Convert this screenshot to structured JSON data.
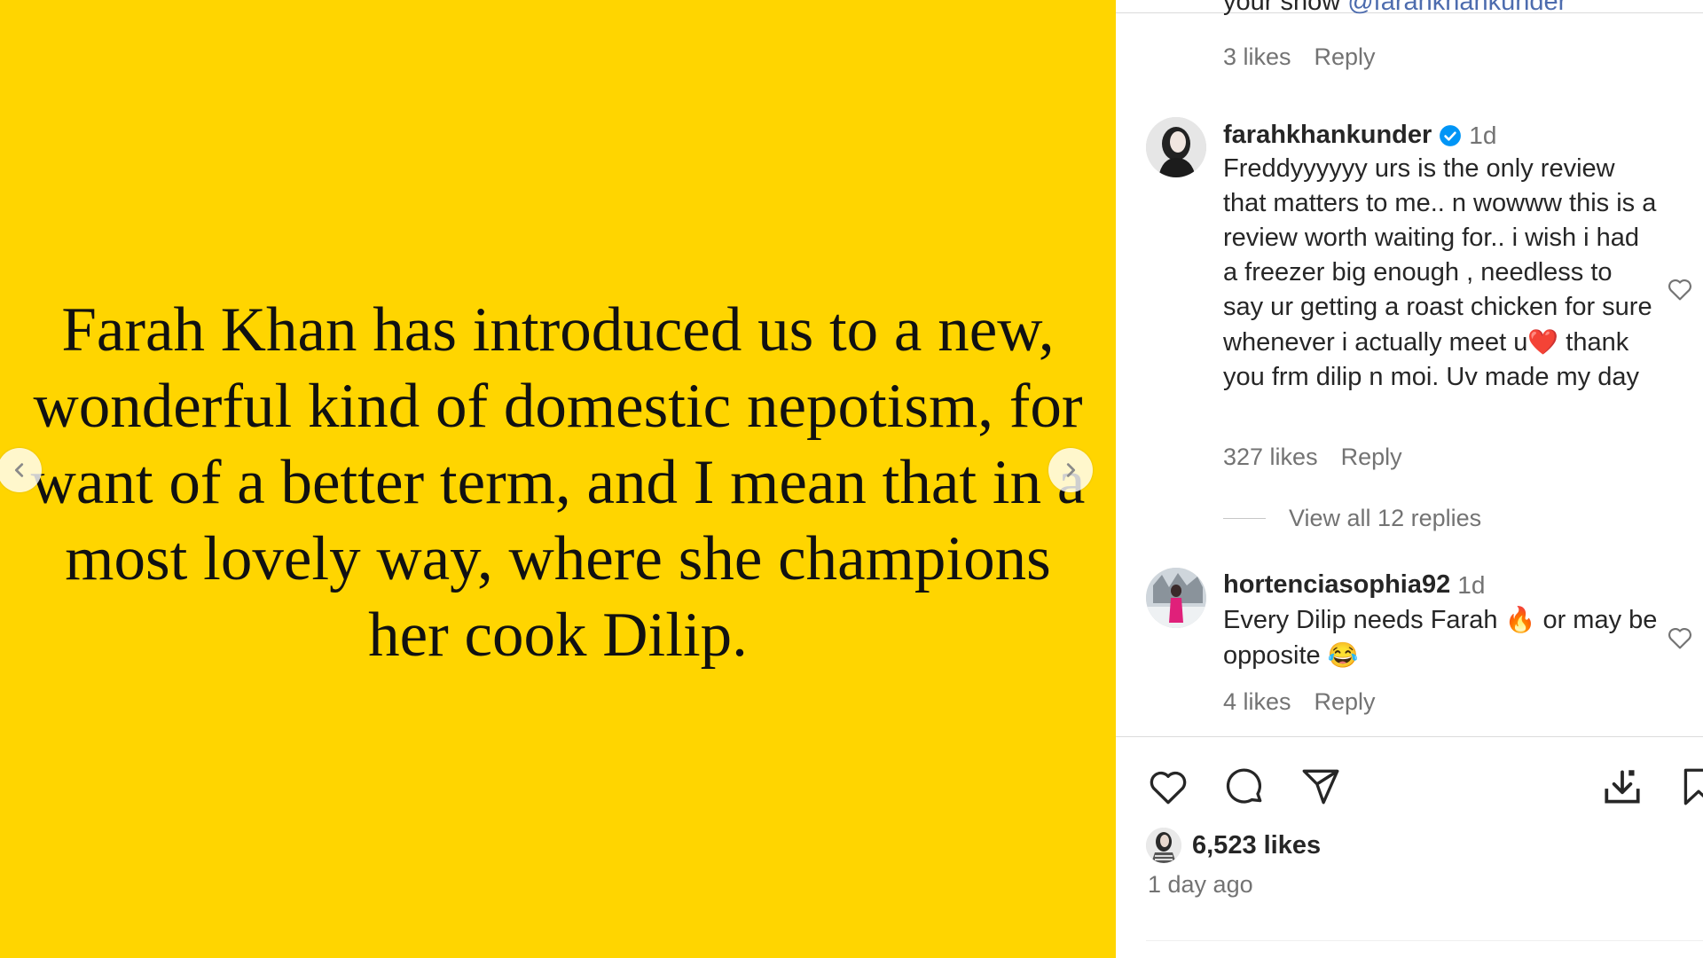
{
  "post": {
    "quote": "Farah Khan has introduced us to a new, wonderful kind of domestic nepotism, for want of a better term, and I mean that in a most lovely way, where she champions her cook Dilip."
  },
  "comments": {
    "clipped": {
      "text": "your show ",
      "mention": "@farahkhankunder",
      "likes": "3 likes",
      "reply": "Reply"
    },
    "main": {
      "username": "farahkhankunder",
      "time": "1d",
      "text": "Freddyyyyyy urs is the only review that matters to me.. n wowww this is a review worth waiting for.. i wish i had a freezer big enough , needless to say ur getting a roast chicken for sure whenever i actually meet u",
      "emoji": "❤️",
      "text_after": " thank you frm dilip n moi. Uv made my day",
      "likes": "327 likes",
      "reply": "Reply",
      "view_replies": "View all 12 replies"
    },
    "second": {
      "username": "hortenciasophia92",
      "time": "1d",
      "text_a": "Every Dilip needs Farah ",
      "emoji_a": "🔥",
      "text_b": " or may be opposite ",
      "emoji_b": "😂",
      "likes": "4 likes",
      "reply": "Reply"
    }
  },
  "footer": {
    "likes": "6,523 likes",
    "date": "1 day ago"
  },
  "icons": [
    "chevron-left-icon",
    "chevron-right-icon",
    "verified-badge-icon",
    "heart-icon",
    "comment-icon",
    "share-icon",
    "download-icon",
    "bookmark-icon"
  ],
  "colors": {
    "media_bg": "#FFD500",
    "verified": "#0095f6",
    "muted": "#737373"
  }
}
